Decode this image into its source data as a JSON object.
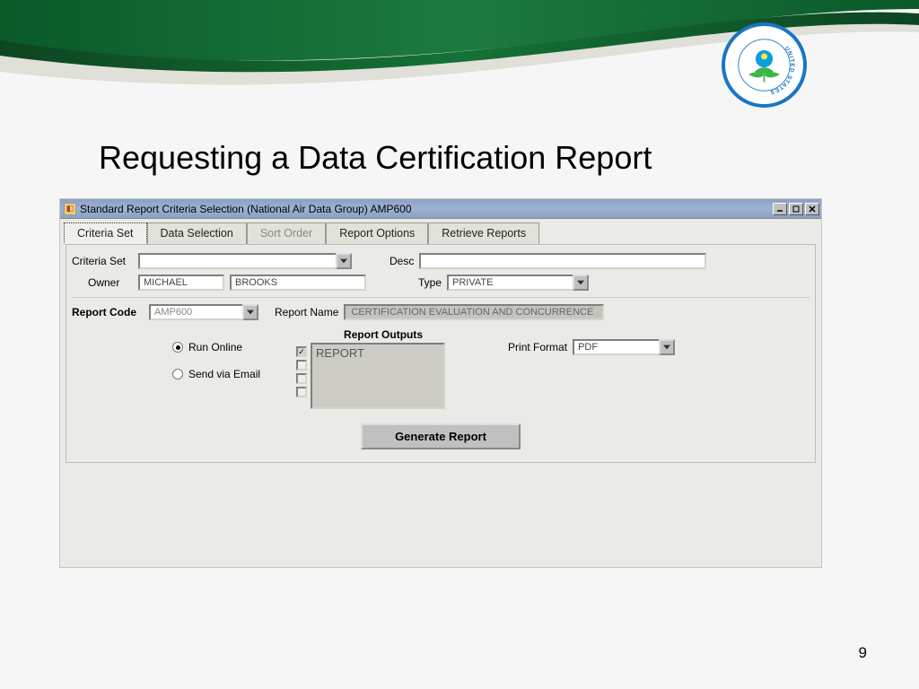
{
  "slide": {
    "title": "Requesting a Data Certification Report",
    "page_number": "9"
  },
  "window": {
    "title": "Standard Report Criteria Selection (National Air Data Group) AMP600"
  },
  "tabs": {
    "criteria_set": "Criteria Set",
    "data_selection": "Data Selection",
    "sort_order": "Sort Order",
    "report_options": "Report Options",
    "retrieve_reports": "Retrieve Reports"
  },
  "form": {
    "criteria_set_label": "Criteria Set",
    "criteria_set_value": "",
    "desc_label": "Desc",
    "desc_value": "",
    "owner_label": "Owner",
    "owner_first": "MICHAEL",
    "owner_last": "BROOKS",
    "type_label": "Type",
    "type_value": "PRIVATE",
    "report_code_label": "Report Code",
    "report_code_value": "AMP600",
    "report_name_label": "Report Name",
    "report_name_value": "CERTIFICATION EVALUATION AND CONCURRENCE",
    "run_online_label": "Run Online",
    "send_via_email_label": "Send via Email",
    "report_outputs_heading": "Report Outputs",
    "outputs_item": "REPORT",
    "print_format_label": "Print Format",
    "print_format_value": "PDF",
    "generate_button": "Generate Report"
  }
}
